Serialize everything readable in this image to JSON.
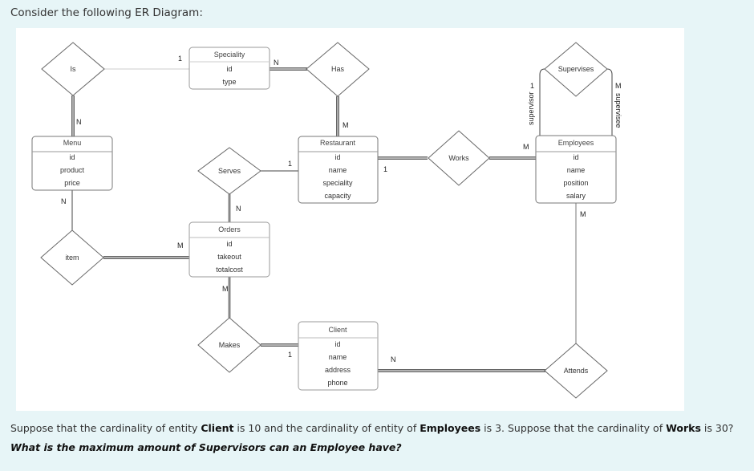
{
  "intro_text": "Consider the following ER Diagram:",
  "diagram": {
    "entities": {
      "speciality": {
        "title": "Speciality",
        "attributes": [
          "id",
          "type"
        ]
      },
      "menu": {
        "title": "Menu",
        "attributes": [
          "id",
          "product",
          "price"
        ]
      },
      "restaurant": {
        "title": "Restaurant",
        "attributes": [
          "id",
          "name",
          "speciality",
          "capacity"
        ]
      },
      "employees": {
        "title": "Employees",
        "attributes": [
          "id",
          "name",
          "position",
          "salary"
        ]
      },
      "orders": {
        "title": "Orders",
        "attributes": [
          "id",
          "takeout",
          "totalcost"
        ]
      },
      "client": {
        "title": "Client",
        "attributes": [
          "id",
          "name",
          "address",
          "phone"
        ]
      }
    },
    "relationships": {
      "is": "Is",
      "has": "Has",
      "supervises": "Supervises",
      "serves": "Serves",
      "works": "Works",
      "item": "item",
      "makes": "Makes",
      "attends": "Attends"
    },
    "cardinalities": {
      "is_speciality": "1",
      "is_menu": "N",
      "has_speciality": "N",
      "has_restaurant": "M",
      "menu_item": "N",
      "item_orders": "M",
      "serves_restaurant": "1",
      "serves_orders": "N",
      "works_restaurant": "1",
      "works_employees": "M",
      "supervises_supervisor": "1",
      "supervises_supervisee": "M",
      "orders_makes": "M",
      "makes_client": "1",
      "client_attends": "N",
      "employees_attends": "M"
    },
    "roles": {
      "supervisor": "supervisor",
      "supervisee": "supervisee"
    }
  },
  "question": {
    "part1_a": "Suppose that the cardinality of entity ",
    "part1_b": "Client",
    "part1_c": " is 10 and the cardinality of entity of ",
    "part1_d": "Employees",
    "part1_e": " is 3. Suppose that the cardinality of ",
    "part1_f": "Works",
    "part1_g": " is 30?",
    "part2": "What is the maximum amount of Supervisors can an Employee have?"
  }
}
